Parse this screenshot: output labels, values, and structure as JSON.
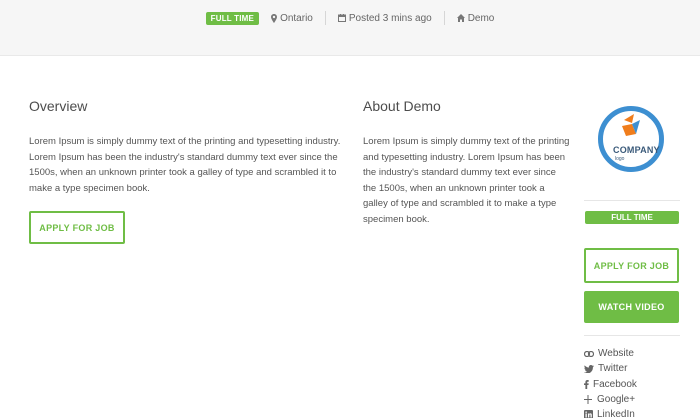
{
  "job_meta": {
    "type_badge": "FULL TIME",
    "location": "Ontario",
    "posted": "Posted 3 mins ago",
    "company": "Demo"
  },
  "overview": {
    "title": "Overview",
    "text": "Lorem Ipsum is simply dummy text of the printing and typesetting industry. Lorem Ipsum has been the industry's standard dummy text ever since the 1500s, when an unknown printer took a galley of type and scrambled it to make a type specimen book.",
    "apply_label": "APPLY FOR JOB"
  },
  "about": {
    "title": "About Demo",
    "text": "Lorem Ipsum is simply dummy text of the printing and typesetting industry. Lorem Ipsum has been the industry's standard dummy text ever since the 1500s, when an unknown printer took a galley of type and scrambled it to make a type specimen book."
  },
  "sidebar": {
    "logo_name": "COMPANY",
    "logo_sub": "logo",
    "type_badge": "FULL TIME",
    "apply_label": "APPLY FOR JOB",
    "video_label": "WATCH VIDEO",
    "links": [
      {
        "label": "Website",
        "icon": "link-icon"
      },
      {
        "label": "Twitter",
        "icon": "twitter-icon"
      },
      {
        "label": "Facebook",
        "icon": "facebook-icon"
      },
      {
        "label": "Google+",
        "icon": "google-plus-icon"
      },
      {
        "label": "LinkedIn",
        "icon": "linkedin-icon"
      }
    ]
  },
  "colors": {
    "accent": "#6fbd45",
    "logo_ring": "#3d8fd1",
    "logo_mark": "#f07d1c"
  }
}
